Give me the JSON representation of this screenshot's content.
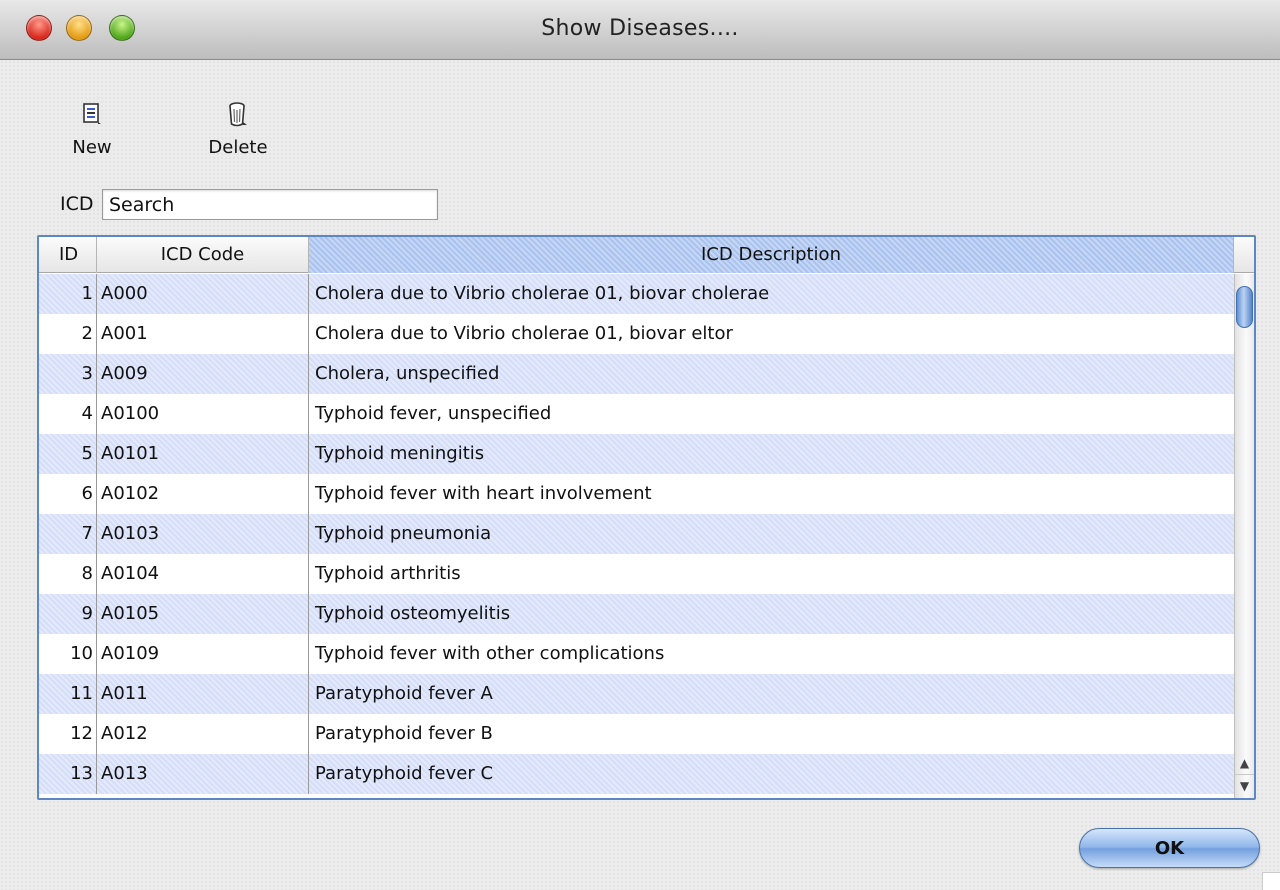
{
  "window": {
    "title": "Show Diseases...."
  },
  "toolbar": {
    "new_label": "New",
    "new_icon": "new-document-icon",
    "delete_label": "Delete",
    "delete_icon": "trash-can-icon"
  },
  "search": {
    "label": "ICD",
    "value": "Search"
  },
  "table": {
    "columns": [
      "ID",
      "ICD Code",
      "ICD Description"
    ],
    "rows": [
      {
        "id": "1",
        "code": "A000",
        "desc": "Cholera due to Vibrio cholerae 01, biovar cholerae"
      },
      {
        "id": "2",
        "code": "A001",
        "desc": "Cholera due to Vibrio cholerae 01, biovar eltor"
      },
      {
        "id": "3",
        "code": "A009",
        "desc": "Cholera, unspecified"
      },
      {
        "id": "4",
        "code": "A0100",
        "desc": "Typhoid fever, unspecified"
      },
      {
        "id": "5",
        "code": "A0101",
        "desc": "Typhoid meningitis"
      },
      {
        "id": "6",
        "code": "A0102",
        "desc": "Typhoid fever with heart involvement"
      },
      {
        "id": "7",
        "code": "A0103",
        "desc": "Typhoid pneumonia"
      },
      {
        "id": "8",
        "code": "A0104",
        "desc": "Typhoid arthritis"
      },
      {
        "id": "9",
        "code": "A0105",
        "desc": "Typhoid osteomyelitis"
      },
      {
        "id": "10",
        "code": "A0109",
        "desc": "Typhoid fever with other complications"
      },
      {
        "id": "11",
        "code": "A011",
        "desc": "Paratyphoid fever A"
      },
      {
        "id": "12",
        "code": "A012",
        "desc": "Paratyphoid fever B"
      },
      {
        "id": "13",
        "code": "A013",
        "desc": "Paratyphoid fever C"
      }
    ]
  },
  "buttons": {
    "ok_label": "OK"
  },
  "colors": {
    "accent_blue": "#5c86c4",
    "row_stripe": "#dde4fa",
    "close": "#d7261b",
    "minimize": "#e39a12",
    "maximize": "#4fa51b"
  }
}
